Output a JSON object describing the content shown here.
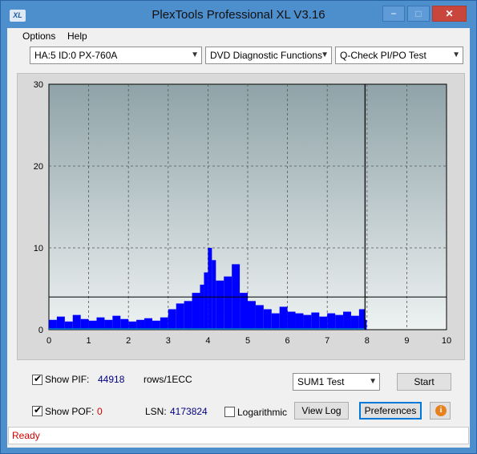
{
  "window": {
    "title": "PlexTools Professional XL V3.16",
    "icon_text": "XL",
    "controls": [
      "−",
      "□",
      "✕"
    ]
  },
  "menu": [
    {
      "label": "Options",
      "accel": "O"
    },
    {
      "label": "Help",
      "accel": "H"
    }
  ],
  "toolbar": {
    "drive": "HA:5 ID:0  PX-760A",
    "function": "DVD Diagnostic Functions",
    "test": "Q-Check PI/PO Test"
  },
  "chart_data": {
    "type": "bar",
    "x_range": [
      0,
      10
    ],
    "y_range": [
      0,
      30
    ],
    "x_ticks": [
      "0",
      "1",
      "2",
      "3",
      "4",
      "5",
      "6",
      "7",
      "8",
      "9",
      "10"
    ],
    "y_ticks": [
      "0",
      "10",
      "20",
      "30"
    ],
    "grid": true,
    "threshold_line": 4,
    "end_marker_x": 7.95,
    "colors": {
      "bars": "#0000ff",
      "po_trace": "#00c0a0",
      "background_top": "#8fa3a8",
      "background_bottom": "#eef2f2",
      "lines": "#000000"
    },
    "series": [
      {
        "x": [
          0.0,
          0.2,
          0.4,
          0.6,
          0.8,
          1.0,
          1.2,
          1.4,
          1.6,
          1.8,
          2.0,
          2.2,
          2.4,
          2.6,
          2.8,
          3.0,
          3.2,
          3.4,
          3.6,
          3.8,
          3.9,
          4.0,
          4.1,
          4.2,
          4.4,
          4.6,
          4.8,
          5.0,
          5.2,
          5.4,
          5.6,
          5.8,
          6.0,
          6.2,
          6.4,
          6.6,
          6.8,
          7.0,
          7.2,
          7.4,
          7.6,
          7.8,
          7.95
        ],
        "values": [
          1.2,
          1.6,
          1.0,
          1.8,
          1.3,
          1.1,
          1.5,
          1.2,
          1.7,
          1.3,
          1.0,
          1.2,
          1.4,
          1.1,
          1.5,
          2.5,
          3.2,
          3.5,
          4.5,
          5.5,
          7.0,
          10.0,
          8.5,
          6.0,
          6.5,
          8.0,
          4.5,
          3.5,
          3.0,
          2.5,
          2.0,
          2.8,
          2.2,
          2.0,
          1.8,
          2.1,
          1.6,
          2.0,
          1.8,
          2.2,
          1.7,
          2.5,
          1.2
        ]
      }
    ]
  },
  "controls": {
    "show_pif_label": "Show PIF:",
    "pif_value": "44918",
    "pif_unit": "rows/1ECC",
    "show_pof_label": "Show POF:",
    "pof_value": "0",
    "lsn_label": "LSN:",
    "lsn_value": "4173824",
    "logarithmic_label": "Logarithmic",
    "sum_select": "SUM1 Test",
    "start_label": "Start",
    "viewlog_label": "View Log",
    "preferences_label": "Preferences"
  },
  "status": "Ready"
}
